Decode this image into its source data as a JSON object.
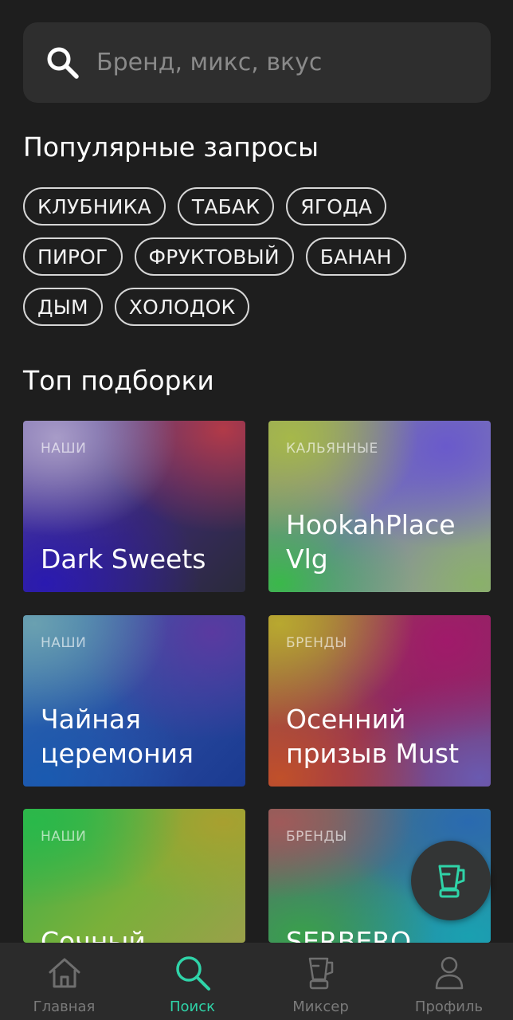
{
  "search": {
    "placeholder": "Бренд, микс, вкус",
    "icon": "search-icon"
  },
  "popular": {
    "title": "Популярные запросы",
    "chips": [
      "КЛУБНИКА",
      "ТАБАК",
      "ЯГОДА",
      "ПИРОГ",
      "ФРУКТОВЫЙ",
      "БАНАН",
      "ДЫМ",
      "ХОЛОДОК"
    ]
  },
  "top": {
    "title": "Топ подборки",
    "cards": [
      {
        "category": "НАШИ",
        "title": "Dark Sweets"
      },
      {
        "category": "КАЛЬЯННЫЕ",
        "title": "HookahPlace Vlg"
      },
      {
        "category": "НАШИ",
        "title": "Чайная церемония"
      },
      {
        "category": "БРЕНДЫ",
        "title": "Осенний призыв Must"
      },
      {
        "category": "НАШИ",
        "title": "Сочный летний"
      },
      {
        "category": "БРЕНДЫ",
        "title": "SERBERO"
      }
    ]
  },
  "fab": {
    "icon": "blender-icon"
  },
  "nav": {
    "items": [
      {
        "label": "Главная",
        "icon": "home-icon"
      },
      {
        "label": "Поиск",
        "icon": "search-icon",
        "active": true
      },
      {
        "label": "Миксер",
        "icon": "blender-icon"
      },
      {
        "label": "Профиль",
        "icon": "user-icon"
      }
    ]
  },
  "colors": {
    "background": "#1e1e1e",
    "accent": "#2fd3a8",
    "search_bg": "#2e2e2e",
    "nav_bg": "#2b2b2b"
  }
}
